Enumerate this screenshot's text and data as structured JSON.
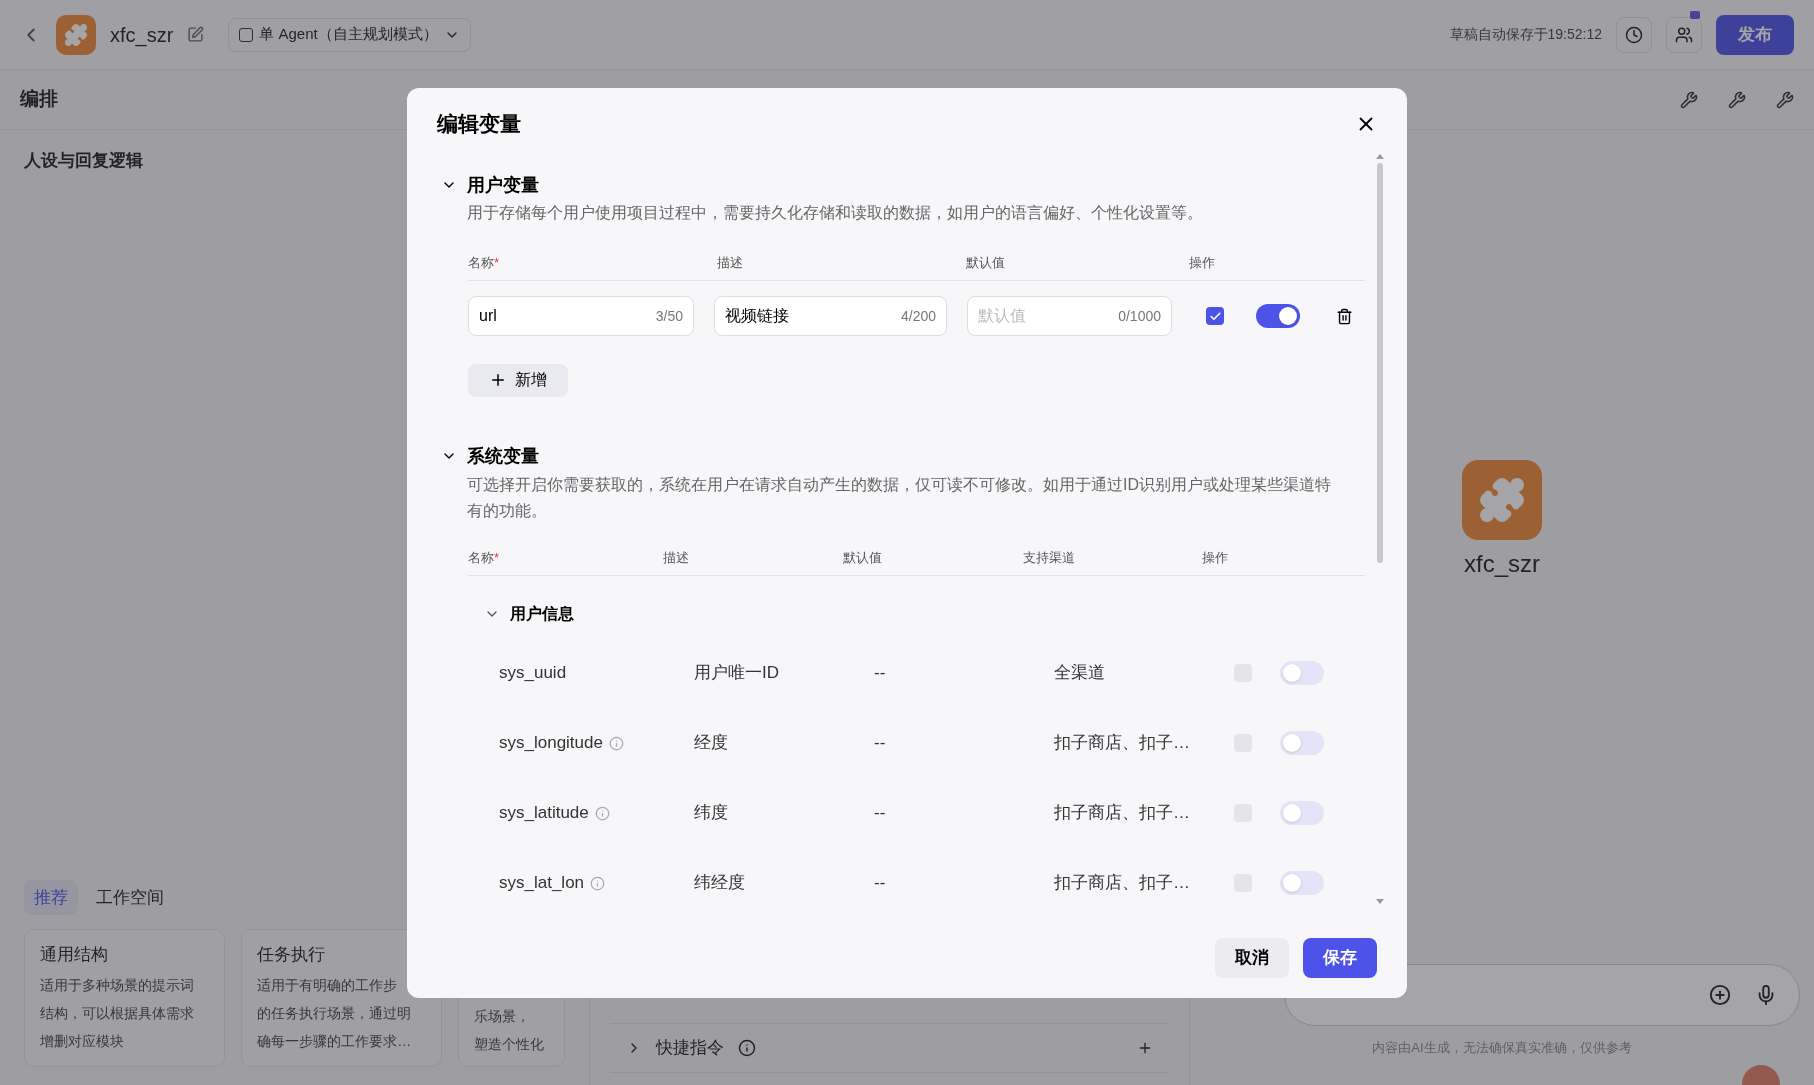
{
  "topbar": {
    "title": "xfc_szr",
    "mode_selector": "单 Agent（自主规划模式）",
    "autosave": "草稿自动保存于19:52:12",
    "publish_button": "发布"
  },
  "toolbar": {
    "title": "编排"
  },
  "prompt_panel": {
    "title": "人设与回复逻辑",
    "tabs": [
      {
        "label": "推荐",
        "selected": true
      },
      {
        "label": "工作空间",
        "selected": false
      }
    ],
    "templates": [
      {
        "title": "通用结构",
        "lines": [
          "适用于多种场景的提示词",
          "结构，可以根据具体需求",
          "增删对应模块"
        ]
      },
      {
        "title": "任务执行",
        "lines": [
          "适用于有明确的工作步",
          "的任务执行场景，通过明",
          "确每一步骤的工作要求…"
        ]
      },
      {
        "lines": [
          "乐场景，",
          "塑造个性化"
        ]
      }
    ]
  },
  "skills": [
    {
      "label": "快捷指令",
      "expanded": false
    }
  ],
  "preview": {
    "bot_name": "xfc_szr",
    "disclaimer": "内容由AI生成，无法确保真实准确，仅供参考"
  },
  "dialog": {
    "title": "编辑变量",
    "user_section": {
      "title": "用户变量",
      "expanded": true,
      "description": "用于存储每个用户使用项目过程中，需要持久化存储和读取的数据，如用户的语言偏好、个性化设置等。",
      "columns": [
        {
          "label": "名称",
          "required_mark": "*"
        },
        {
          "label": "描述"
        },
        {
          "label": "默认值"
        },
        {
          "label": "操作"
        }
      ],
      "rows": [
        {
          "name": "url",
          "name_count": "3/50",
          "description": "视频链接",
          "description_count": "4/200",
          "default_placeholder": "默认值",
          "default_count": "0/1000",
          "checked": true,
          "on": true
        }
      ],
      "add_button": "新增"
    },
    "system_section": {
      "title": "系统变量",
      "expanded": true,
      "description": "可选择开启你需要获取的，系统在用户在请求自动产生的数据，仅可读不可修改。如用于通过ID识别用户或处理某些渠道特有的功能。",
      "columns": [
        {
          "label": "名称",
          "required_mark": "*"
        },
        {
          "label": "描述"
        },
        {
          "label": "默认值"
        },
        {
          "label": "支持渠道"
        },
        {
          "label": "操作"
        }
      ],
      "groups": [
        {
          "title": "用户信息",
          "expanded": true,
          "rows": [
            {
              "name": "sys_uuid",
              "info": false,
              "description": "用户唯一ID",
              "default": "--",
              "channels": "全渠道",
              "checked": false,
              "on": false
            },
            {
              "name": "sys_longitude",
              "info": true,
              "description": "经度",
              "default": "--",
              "channels": "扣子商店、扣子…",
              "checked": false,
              "on": false
            },
            {
              "name": "sys_latitude",
              "info": true,
              "description": "纬度",
              "default": "--",
              "channels": "扣子商店、扣子…",
              "checked": false,
              "on": false
            },
            {
              "name": "sys_lat_lon",
              "info": true,
              "description": "纬经度",
              "default": "--",
              "channels": "扣子商店、扣子…",
              "checked": false,
              "on": false
            }
          ]
        }
      ]
    },
    "buttons": {
      "cancel": "取消",
      "save": "保存"
    }
  }
}
